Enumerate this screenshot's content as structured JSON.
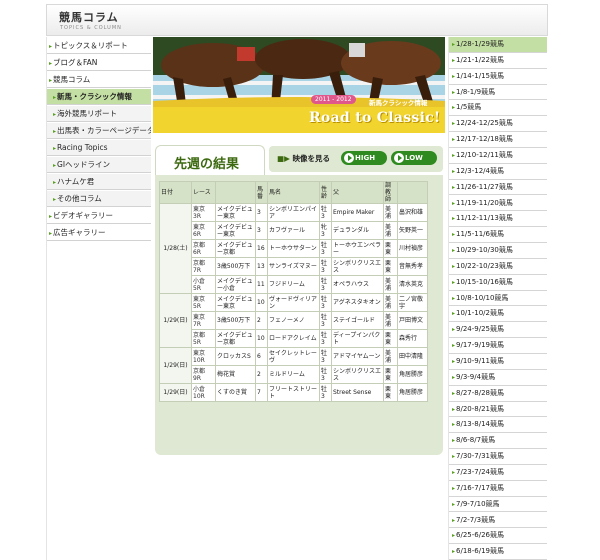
{
  "header": {
    "title": "競馬コラム",
    "subtitle": "TOPICS & COLUMN"
  },
  "leftnav": {
    "items": [
      {
        "label": "トピックス＆リポート",
        "level": 0,
        "active": false
      },
      {
        "label": "ブログ＆FAN",
        "level": 0,
        "active": false
      },
      {
        "label": "競馬コラム",
        "level": 0,
        "active": false
      },
      {
        "label": "新馬・クラシック情報",
        "level": 1,
        "active": true
      },
      {
        "label": "海外競馬リポート",
        "level": 1,
        "active": false
      },
      {
        "label": "出馬表・カラーページデータ",
        "level": 1,
        "active": false
      },
      {
        "label": "Racing Topics",
        "level": 1,
        "active": false
      },
      {
        "label": "GIヘッドライン",
        "level": 1,
        "active": false
      },
      {
        "label": "ハナムケ君",
        "level": 1,
        "active": false
      },
      {
        "label": "その他コラム",
        "level": 1,
        "active": false
      },
      {
        "label": "ビデオギャラリー",
        "level": 0,
        "active": false
      },
      {
        "label": "広告ギャラリー",
        "level": 0,
        "active": false
      }
    ]
  },
  "banner": {
    "season": "2011 - 2012",
    "subtitle": "新馬クラシック情報",
    "title": "Road to Classic!"
  },
  "tabs": {
    "results": "先週の結果",
    "video_label": "映像を見る",
    "high": "HIGH",
    "low": "LOW"
  },
  "table": {
    "headers": [
      "日付",
      "レース",
      "",
      "馬番",
      "馬名",
      "性齢",
      "父",
      "調教師"
    ],
    "groups": [
      {
        "date": "1/28(土)",
        "rows": [
          {
            "venue": "東京 3R",
            "race": "メイクデビュー東京",
            "no": "3",
            "horse": "シンボリエンパイア",
            "sexage": "牡3",
            "sire": "Empire Maker",
            "tr_loc": "美浦",
            "trainer": "畠沢和雄"
          },
          {
            "venue": "東京 6R",
            "race": "メイクデビュー東京",
            "no": "3",
            "horse": "カフヴァール",
            "sexage": "牝3",
            "sire": "デュランダル",
            "tr_loc": "美浦",
            "trainer": "矢野英一"
          },
          {
            "venue": "京都 6R",
            "race": "メイクデビュー京都",
            "no": "16",
            "horse": "トーホウサターン",
            "sexage": "牡3",
            "sire": "トーホウエンペラー",
            "tr_loc": "栗東",
            "trainer": "川村禎彦"
          },
          {
            "venue": "京都 7R",
            "race": "3歳500万下",
            "no": "13",
            "horse": "サンライズマヌー",
            "sexage": "牡3",
            "sire": "シンボリクリスエス",
            "tr_loc": "栗東",
            "trainer": "音無秀孝"
          },
          {
            "venue": "小倉 5R",
            "race": "メイクデビュー小倉",
            "no": "11",
            "horse": "フジドリーム",
            "sexage": "牡3",
            "sire": "オペラハウス",
            "tr_loc": "美浦",
            "trainer": "清水英克"
          }
        ]
      },
      {
        "date": "1/29(日)",
        "rows": [
          {
            "venue": "東京 5R",
            "race": "メイクデビュー東京",
            "no": "10",
            "horse": "ヴォードヴィリアン",
            "sexage": "牡3",
            "sire": "アグネスタキオン",
            "tr_loc": "美浦",
            "trainer": "二ノ宮敬宇"
          },
          {
            "venue": "東京 7R",
            "race": "3歳500万下",
            "no": "2",
            "horse": "フェノーメノ",
            "sexage": "牡3",
            "sire": "ステイゴールド",
            "tr_loc": "美浦",
            "trainer": "戸田博文"
          },
          {
            "venue": "京都 5R",
            "race": "メイクデビュー京都",
            "no": "10",
            "horse": "ロードアクレイム",
            "sexage": "牡3",
            "sire": "ディープインパクト",
            "tr_loc": "栗東",
            "trainer": "森秀行"
          }
        ]
      },
      {
        "date": "1/29(日)",
        "rows": [
          {
            "venue": "東京 10R",
            "race": "クロッカスS",
            "no": "6",
            "horse": "セイクレットレーヴ",
            "sexage": "牡3",
            "sire": "アドマイヤムーン",
            "tr_loc": "美浦",
            "trainer": "田中清隆"
          },
          {
            "venue": "京都 9R",
            "race": "梅花賞",
            "no": "2",
            "horse": "ミルドリーム",
            "sexage": "牡3",
            "sire": "シンボリクリスエス",
            "tr_loc": "栗東",
            "trainer": "角居勝彦"
          }
        ]
      },
      {
        "date": "1/29(日)",
        "rows": [
          {
            "venue": "小倉 10R",
            "race": "くすのき賞",
            "no": "7",
            "horse": "フリートストリート",
            "sexage": "牡3",
            "sire": "Street Sense",
            "tr_loc": "栗東",
            "trainer": "角居勝彦"
          }
        ]
      }
    ]
  },
  "rightlist": {
    "items": [
      "1/28-1/29競馬",
      "1/21-1/22競馬",
      "1/14-1/15競馬",
      "1/8-1/9競馬",
      "1/5競馬",
      "12/24-12/25競馬",
      "12/17-12/18競馬",
      "12/10-12/11競馬",
      "12/3-12/4競馬",
      "11/26-11/27競馬",
      "11/19-11/20競馬",
      "11/12-11/13競馬",
      "11/5-11/6競馬",
      "10/29-10/30競馬",
      "10/22-10/23競馬",
      "10/15-10/16競馬",
      "10/8-10/10競馬",
      "10/1-10/2競馬",
      "9/24-9/25競馬",
      "9/17-9/19競馬",
      "9/10-9/11競馬",
      "9/3-9/4競馬",
      "8/27-8/28競馬",
      "8/20-8/21競馬",
      "8/13-8/14競馬",
      "8/6-8/7競馬",
      "7/30-7/31競馬",
      "7/23-7/24競馬",
      "7/16-7/17競馬",
      "7/9-7/10競馬",
      "7/2-7/3競馬",
      "6/25-6/26競馬",
      "6/18-6/19競馬"
    ]
  },
  "colors": {
    "accent_green": "#2f8a1f",
    "active_bg": "#c3dfa3",
    "panel_bg": "#dfe8d2",
    "banner_yellow": "#f1d52e"
  }
}
